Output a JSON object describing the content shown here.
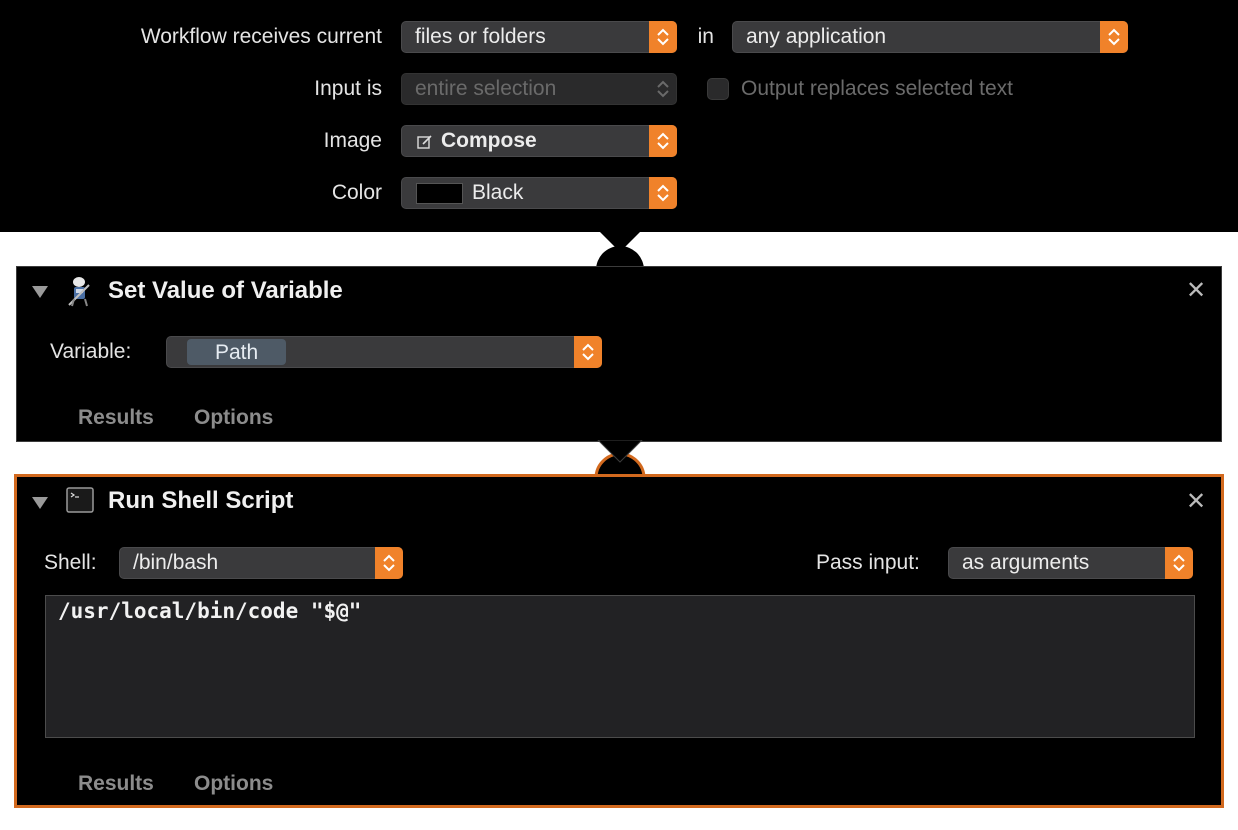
{
  "header": {
    "receives_label": "Workflow receives current",
    "receives_value": "files or folders",
    "in_label": "in",
    "application_value": "any application",
    "input_label": "Input is",
    "input_value": "entire selection",
    "output_checkbox_label": "Output replaces selected text",
    "image_label": "Image",
    "image_value": "Compose",
    "image_icon": "pencil-square-icon",
    "color_label": "Color",
    "color_value": "Black",
    "color_swatch": "#000000"
  },
  "actions": [
    {
      "title": "Set Value of Variable",
      "icon": "automator-robot-icon",
      "variable_label": "Variable:",
      "variable_value": "Path",
      "tabs": [
        "Results",
        "Options"
      ]
    },
    {
      "title": "Run Shell Script",
      "icon": "terminal-icon",
      "shell_label": "Shell:",
      "shell_value": "/bin/bash",
      "pass_input_label": "Pass input:",
      "pass_input_value": "as arguments",
      "script": "/usr/local/bin/code \"$@\"",
      "tabs": [
        "Results",
        "Options"
      ]
    }
  ],
  "colors": {
    "accent": "#f0822a",
    "selected_border": "#d2691e",
    "background": "#000000"
  }
}
